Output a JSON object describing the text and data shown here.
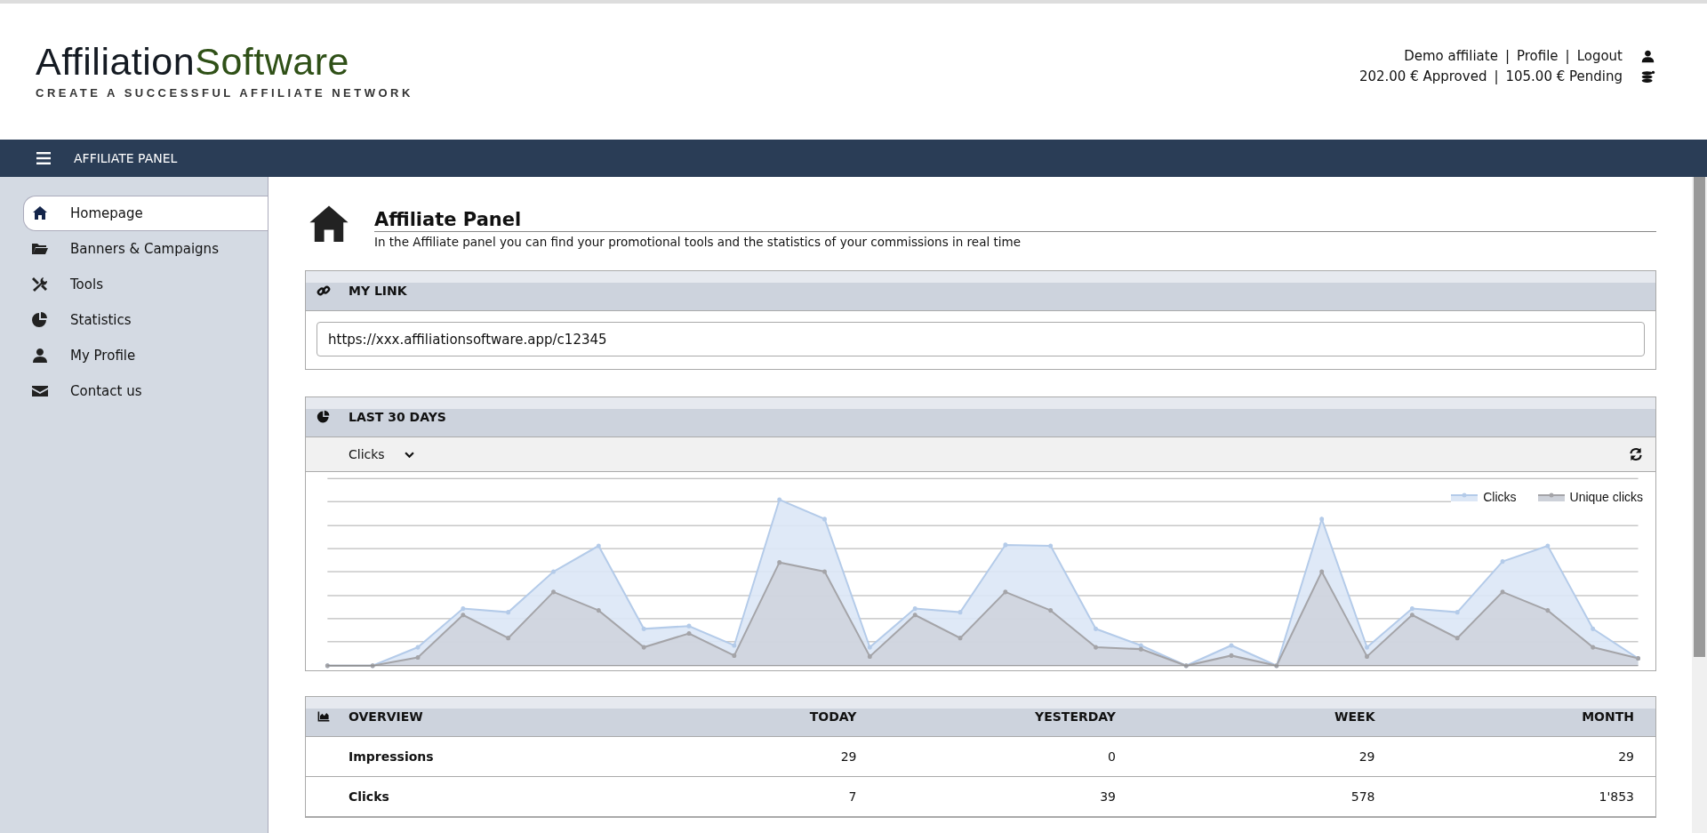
{
  "logo": {
    "name_dark": "Affiliation",
    "name_green": "Software",
    "tagline": "CREATE A SUCCESSFUL AFFILIATE NETWORK"
  },
  "account": {
    "line_1": [
      {
        "text": "Demo affiliate",
        "kind": "name"
      },
      {
        "text": "|",
        "kind": "separator"
      },
      {
        "text": "Profile",
        "kind": "link"
      },
      {
        "text": "|",
        "kind": "separator"
      },
      {
        "text": "Logout",
        "kind": "link"
      }
    ],
    "line_2": [
      {
        "text": "202.00 € Approved",
        "kind": "amount"
      },
      {
        "text": "|",
        "kind": "separator"
      },
      {
        "text": "105.00 € Pending",
        "kind": "amount"
      }
    ]
  },
  "navbar": {
    "title": "AFFILIATE PANEL"
  },
  "sidebar": {
    "items": [
      {
        "label": "Homepage",
        "selected": true
      },
      {
        "label": "Banners & Campaigns",
        "selected": false
      },
      {
        "label": "Tools",
        "selected": false
      },
      {
        "label": "Statistics",
        "selected": false
      },
      {
        "label": "My Profile",
        "selected": false
      },
      {
        "label": "Contact us",
        "selected": false
      }
    ]
  },
  "page": {
    "title": "Affiliate Panel",
    "subtitle": "In the Affiliate panel you can find your promotional tools and the statistics of your commissions in real time"
  },
  "my_link": {
    "title": "MY LINK",
    "value": "https://xxx.affiliationsoftware.app/c12345"
  },
  "last_30_days": {
    "title": "LAST 30 DAYS",
    "metric": "Clicks",
    "legend": [
      "Clicks",
      "Unique clicks"
    ]
  },
  "overview": {
    "columns": [
      "OVERVIEW",
      "TODAY",
      "YESTERDAY",
      "WEEK",
      "MONTH"
    ],
    "rows": [
      {
        "label": "Impressions",
        "values": [
          "29",
          "0",
          "29",
          "29"
        ]
      },
      {
        "label": "Clicks",
        "values": [
          "7",
          "39",
          "578",
          "1'853"
        ]
      }
    ]
  }
}
